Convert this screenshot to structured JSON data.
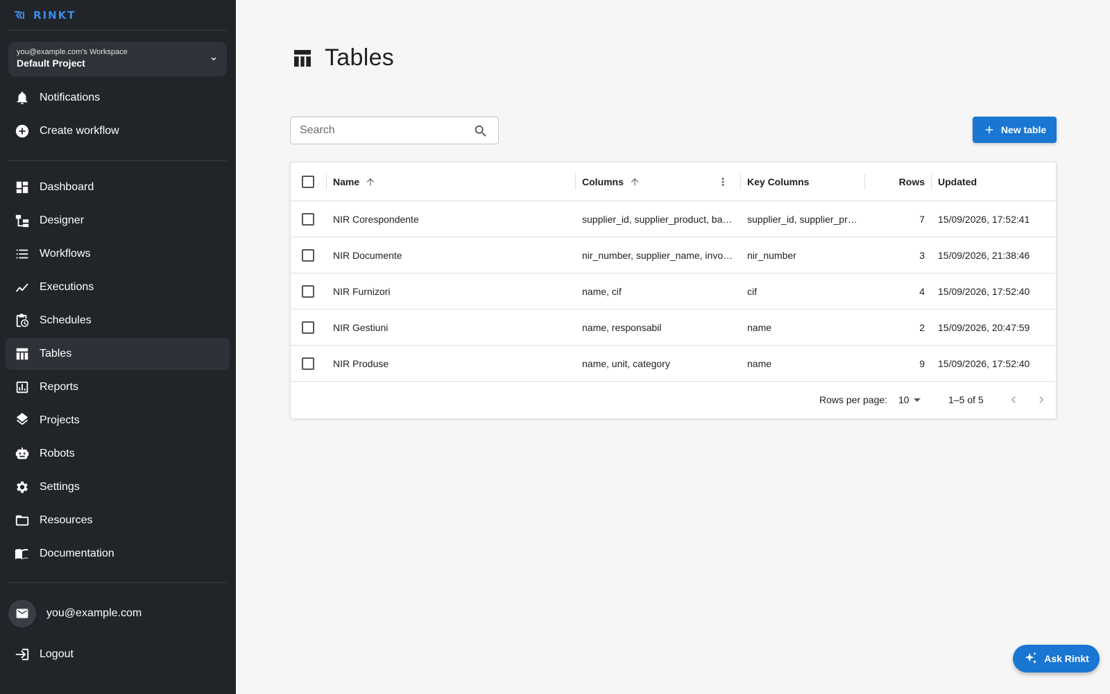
{
  "app": {
    "logo_text": "RINKT"
  },
  "workspace": {
    "email": "you@example.com's Workspace",
    "project": "Default Project"
  },
  "nav": {
    "top": [
      {
        "label": "Notifications",
        "icon": "bell-icon"
      },
      {
        "label": "Create workflow",
        "icon": "add-circle-icon"
      }
    ],
    "main": [
      {
        "label": "Dashboard",
        "icon": "dashboard-icon"
      },
      {
        "label": "Designer",
        "icon": "designer-icon"
      },
      {
        "label": "Workflows",
        "icon": "list-icon"
      },
      {
        "label": "Executions",
        "icon": "trend-icon"
      },
      {
        "label": "Schedules",
        "icon": "schedule-icon"
      },
      {
        "label": "Tables",
        "icon": "table-icon",
        "active": true
      },
      {
        "label": "Reports",
        "icon": "report-icon"
      },
      {
        "label": "Projects",
        "icon": "layers-icon"
      },
      {
        "label": "Robots",
        "icon": "robot-icon"
      },
      {
        "label": "Settings",
        "icon": "gear-icon"
      },
      {
        "label": "Resources",
        "icon": "folder-icon"
      },
      {
        "label": "Documentation",
        "icon": "book-icon"
      }
    ]
  },
  "user": {
    "email": "you@example.com",
    "logout_label": "Logout"
  },
  "page": {
    "title": "Tables"
  },
  "search": {
    "placeholder": "Search",
    "value": ""
  },
  "toolbar": {
    "new_table_label": "New table"
  },
  "table": {
    "headers": {
      "name": "Name",
      "columns": "Columns",
      "key_columns": "Key Columns",
      "rows": "Rows",
      "updated": "Updated"
    },
    "rows": [
      {
        "name": "NIR Corespondente",
        "columns": "supplier_id, supplier_product, ba…",
        "key_columns": "supplier_id, supplier_pr…",
        "rows": "7",
        "updated": "15/09/2026, 17:52:41"
      },
      {
        "name": "NIR Documente",
        "columns": "nir_number, supplier_name, invoi…",
        "key_columns": "nir_number",
        "rows": "3",
        "updated": "15/09/2026, 21:38:46"
      },
      {
        "name": "NIR Furnizori",
        "columns": "name, cif",
        "key_columns": "cif",
        "rows": "4",
        "updated": "15/09/2026, 17:52:40"
      },
      {
        "name": "NIR Gestiuni",
        "columns": "name, responsabil",
        "key_columns": "name",
        "rows": "2",
        "updated": "15/09/2026, 20:47:59"
      },
      {
        "name": "NIR Produse",
        "columns": "name, unit, category",
        "key_columns": "name",
        "rows": "9",
        "updated": "15/09/2026, 17:52:40"
      }
    ]
  },
  "pagination": {
    "rows_per_page_label": "Rows per page:",
    "rows_per_page": "10",
    "range": "1–5 of 5"
  },
  "assistant": {
    "label": "Ask Rinkt"
  },
  "colors": {
    "sidebar_bg": "#212429",
    "accent": "#1976d2",
    "page_bg": "#f6f6f6"
  }
}
